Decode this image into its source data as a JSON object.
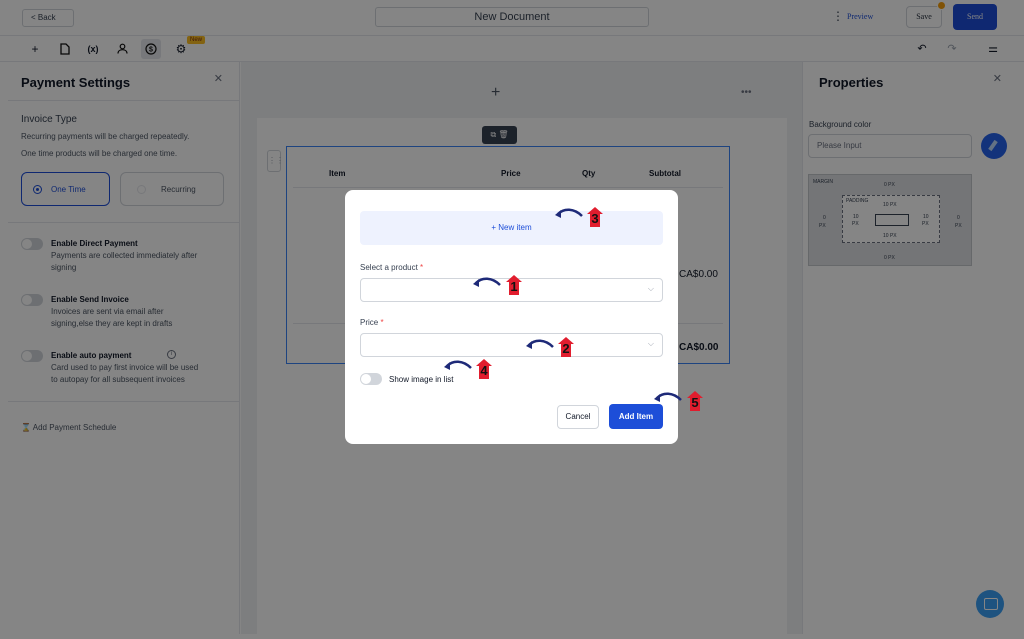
{
  "header": {
    "back_label": "< Back",
    "document_title": "New Document",
    "more_icon": "kebab-icon",
    "preview_label": "Preview",
    "save_label": "Save",
    "send_label": "Send"
  },
  "toolbar": {
    "new_badge": "New",
    "icons": [
      "plus-icon",
      "page-icon",
      "variable-icon",
      "user-icon",
      "dollar-icon",
      "gear-icon",
      "undo-icon",
      "redo-icon",
      "settings-sliders-icon"
    ]
  },
  "left_panel": {
    "title": "Payment Settings",
    "invoice_type": {
      "title": "Invoice Type",
      "desc1": "Recurring payments will be charged repeatedly.",
      "desc2": "One time products will be charged one time.",
      "option_one_time": "One Time",
      "option_recurring": "Recurring"
    },
    "toggles": [
      {
        "label": "Enable Direct Payment",
        "desc1": "Payments are collected immediately after",
        "desc2": "signing"
      },
      {
        "label": "Enable Send Invoice",
        "desc1": "Invoices are sent via email after",
        "desc2": "signing,else they are kept in drafts"
      },
      {
        "label": "Enable auto payment",
        "desc1": "Card used to pay first invoice will be used",
        "desc2": "to autopay for all subsequent invoices"
      }
    ],
    "add_schedule": "⌛ Add Payment Schedule"
  },
  "canvas": {
    "table": {
      "headers": [
        "Item",
        "Price",
        "Qty",
        "Subtotal"
      ],
      "amount1": "CA$0.00",
      "amount2": "CA$0.00"
    }
  },
  "modal": {
    "new_item_label": "+ New item",
    "select_product_label": "Select a product",
    "price_label": "Price",
    "required_mark": "*",
    "show_image_label": "Show image in list",
    "cancel_label": "Cancel",
    "add_item_label": "Add Item"
  },
  "right_panel": {
    "title": "Properties",
    "bg_color_label": "Background color",
    "bg_color_placeholder": "Please Input",
    "box_model": {
      "margin_label": "MARGIN",
      "padding_label": "PADDING",
      "margin_top": "0 PX",
      "margin_bottom": "0 PX",
      "margin_left": "0",
      "margin_right": "0",
      "padding_top": "10 PX",
      "padding_bottom": "10 PX",
      "padding_left": "10",
      "padding_right": "10",
      "unit": "PX"
    }
  },
  "annotations": [
    "1",
    "2",
    "3",
    "4",
    "5"
  ],
  "colors": {
    "accent": "#1d4ed8",
    "marker": "#e11d2e",
    "arrow": "#1e2a78"
  }
}
